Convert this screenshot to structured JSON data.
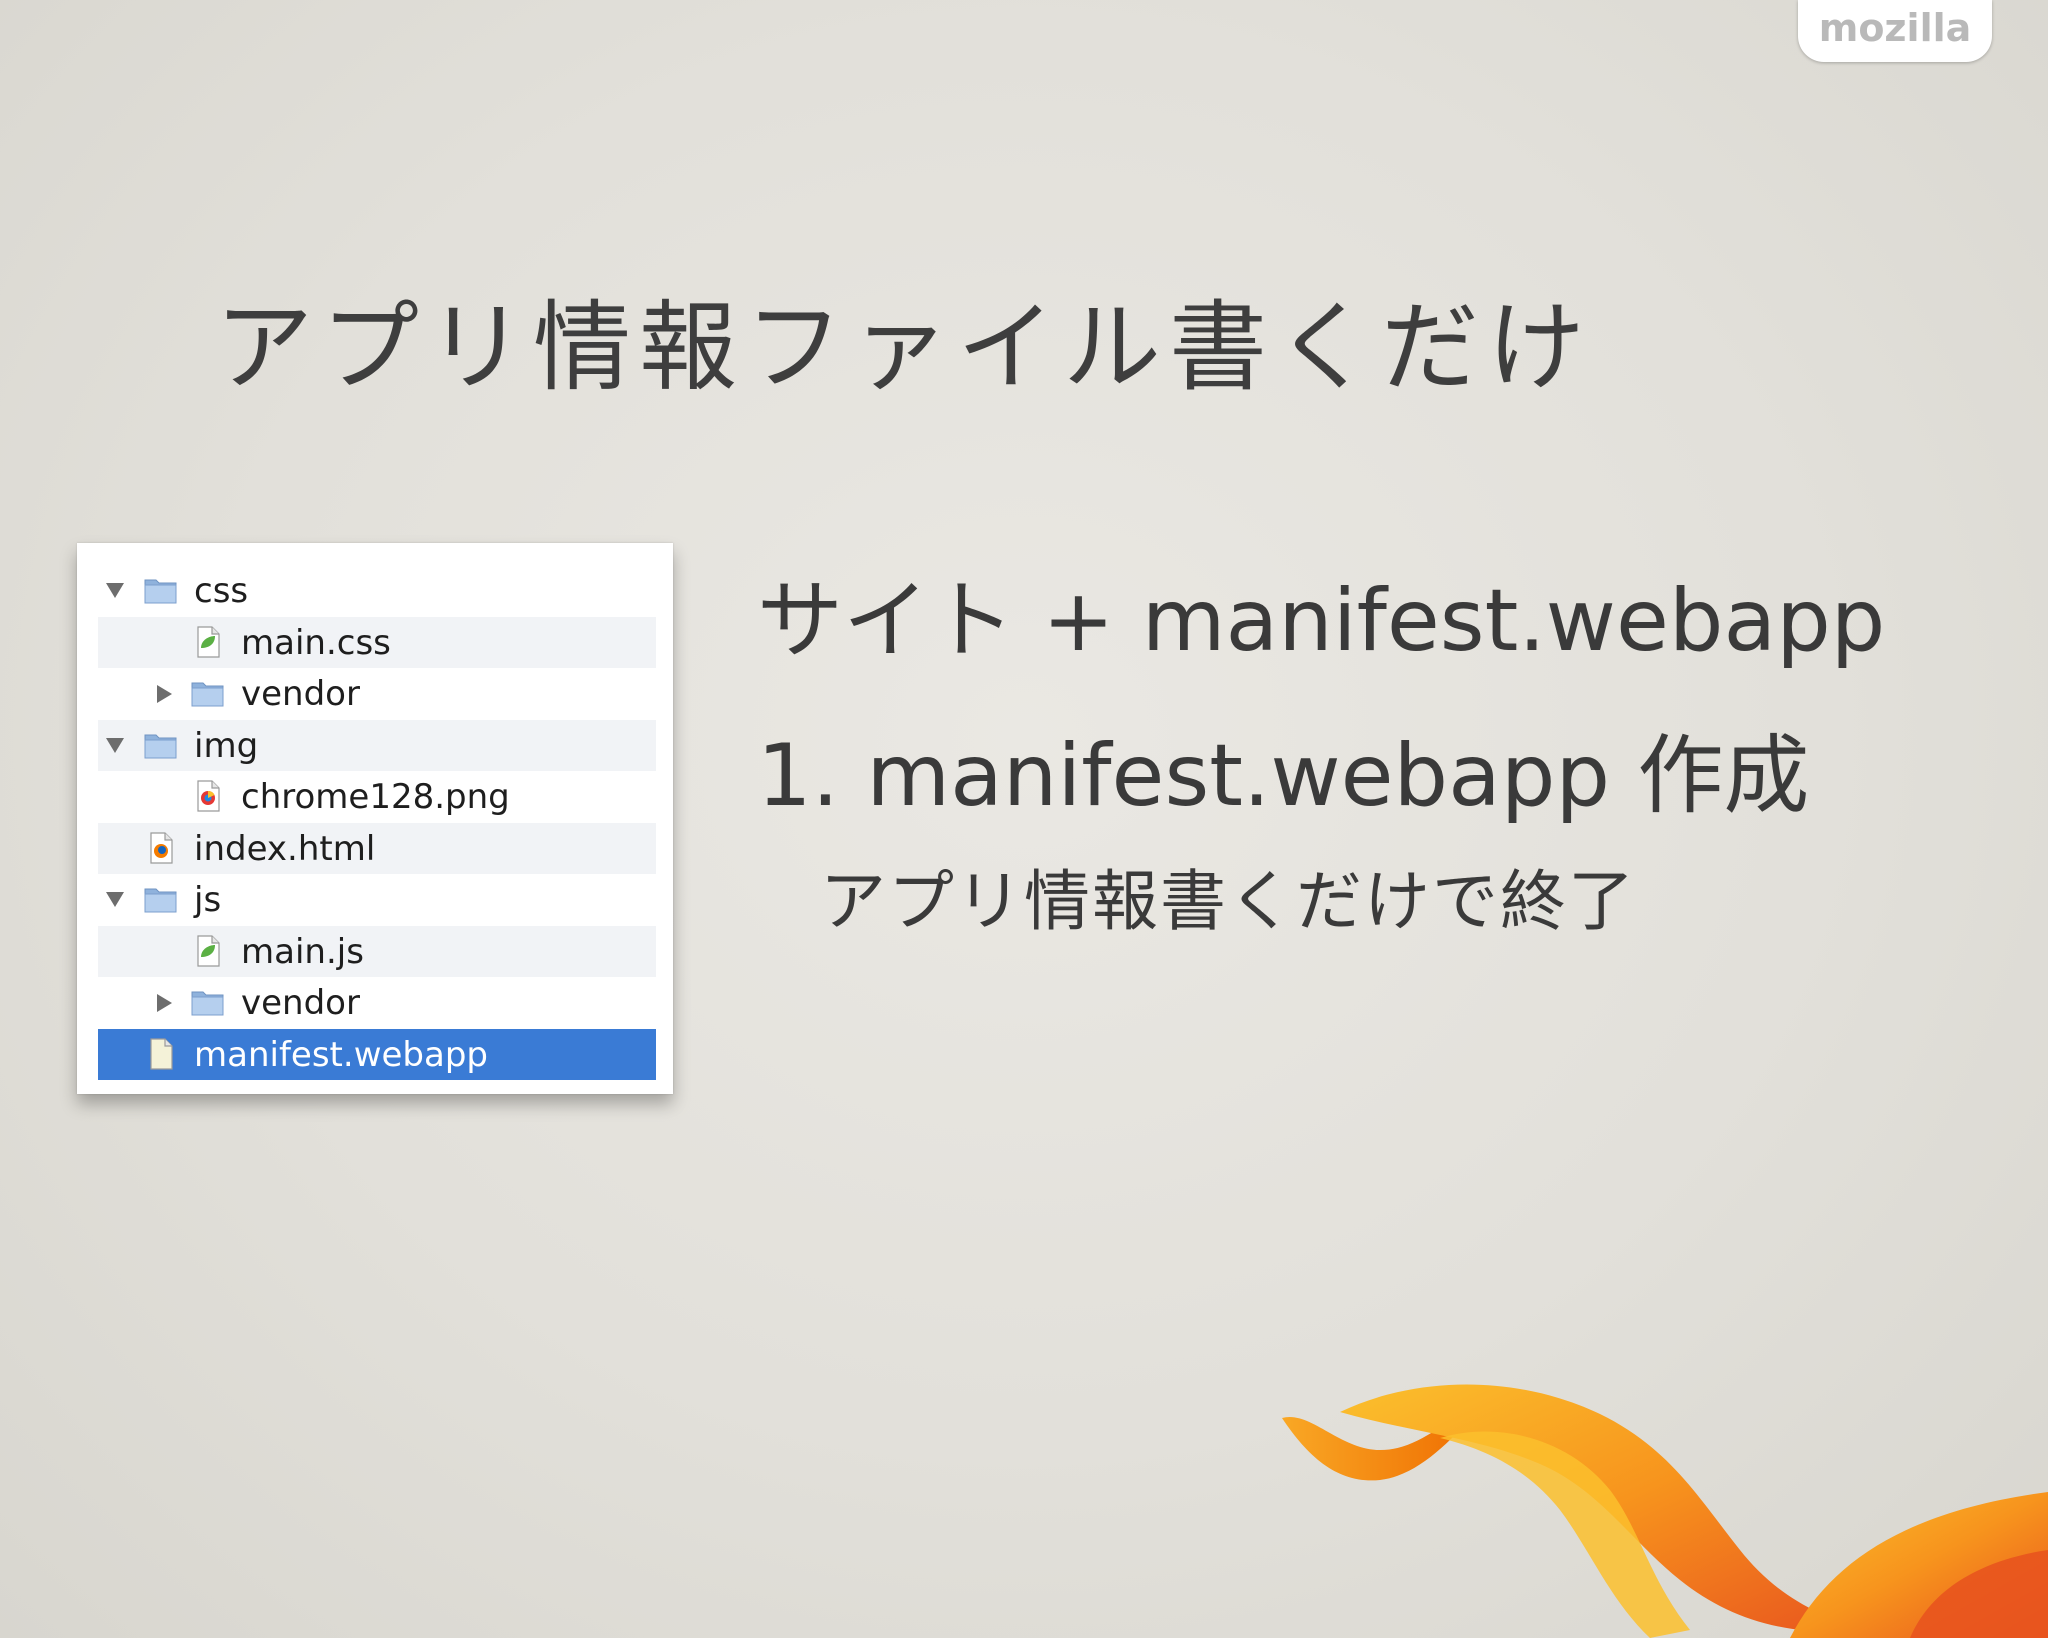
{
  "brand": {
    "label": "mozilla"
  },
  "slide": {
    "title": "アプリ情報ファイル書くだけ",
    "line1": "サイト + manifest.webapp",
    "line2": "1. manifest.webapp 作成",
    "line3": "アプリ情報書くだけで終了"
  },
  "tree": {
    "items": [
      {
        "label": "css",
        "kind": "folder",
        "depth": 0,
        "expanded": true
      },
      {
        "label": "main.css",
        "kind": "leaf-file",
        "depth": 1
      },
      {
        "label": "vendor",
        "kind": "folder",
        "depth": 1,
        "expanded": false
      },
      {
        "label": "img",
        "kind": "folder",
        "depth": 0,
        "expanded": true
      },
      {
        "label": "chrome128.png",
        "kind": "image-file",
        "depth": 1
      },
      {
        "label": "index.html",
        "kind": "html-file",
        "depth": 0
      },
      {
        "label": "js",
        "kind": "folder",
        "depth": 0,
        "expanded": true
      },
      {
        "label": "main.js",
        "kind": "leaf-file",
        "depth": 1
      },
      {
        "label": "vendor",
        "kind": "folder",
        "depth": 1,
        "expanded": false
      },
      {
        "label": "manifest.webapp",
        "kind": "plain-file",
        "depth": 0,
        "selected": true
      }
    ]
  },
  "colors": {
    "selection": "#3a7bd5",
    "folder": "#9cbde4",
    "flame_orange": "#f7941d",
    "flame_red": "#e8541e",
    "flame_yellow": "#fbc02d"
  }
}
